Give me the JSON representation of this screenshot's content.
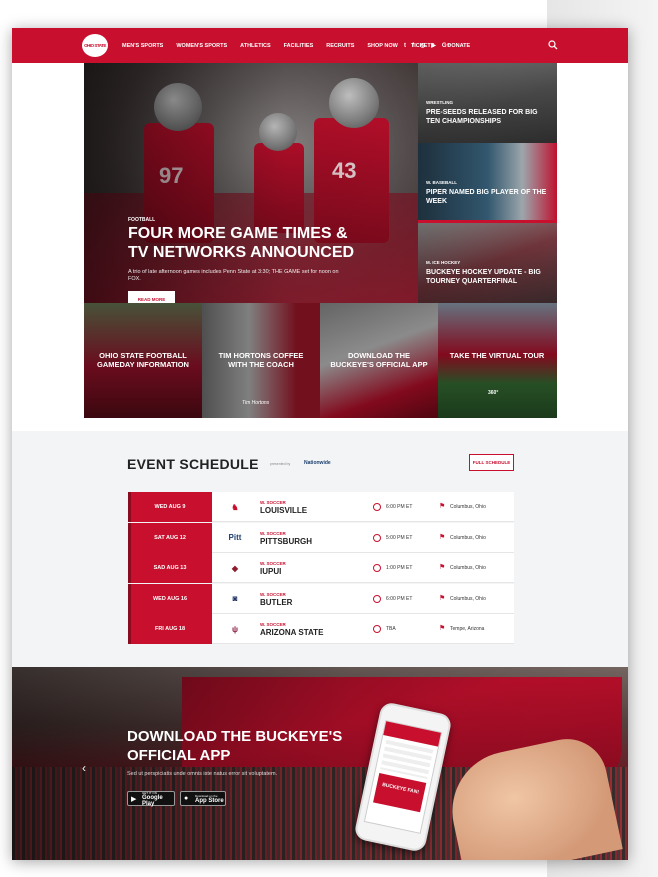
{
  "nav": {
    "logo_text": "OHIO STATE",
    "links": [
      "MEN'S SPORTS",
      "WOMEN'S SPORTS",
      "ATHLETICS",
      "FACILITIES",
      "RECRUITS",
      "SHOP NOW",
      "TICKETS",
      "DONATE"
    ],
    "socials": [
      "t",
      "f",
      "◎",
      "▶",
      "G+"
    ]
  },
  "hero": {
    "category": "FOOTBALL",
    "title": "FOUR MORE GAME TIMES & TV NETWORKS ANNOUNCED",
    "description": "A trio of late afternoon games includes Penn State at 3:30; THE GAME set for noon on FOX.",
    "button": "READ MORE",
    "jersey_numbers": [
      "97",
      "43"
    ]
  },
  "side_stories": [
    {
      "category": "WRESTLING",
      "title": "PRE-SEEDS RELEASED FOR BIG TEN CHAMPIONSHIPS"
    },
    {
      "category": "W. BASEBALL",
      "title": "PIPER NAMED BIG PLAYER OF THE WEEK"
    },
    {
      "category": "M. ICE HOCKEY",
      "title": "BUCKEYE HOCKEY UPDATE - BIG TOURNEY QUARTERFINAL"
    }
  ],
  "tiles": [
    {
      "title": "OHIO STATE FOOTBALL GAMEDAY INFORMATION"
    },
    {
      "title": "TIM HORTONS COFFEE WITH THE COACH",
      "sponsor": "Tim Hortons"
    },
    {
      "title": "DOWNLOAD THE BUCKEYE'S OFFICIAL APP"
    },
    {
      "title": "TAKE THE VIRTUAL TOUR",
      "badge": "360°"
    }
  ],
  "schedule": {
    "title": "EVENT SCHEDULE",
    "presented_by": "presented by",
    "sponsor": "Nationwide",
    "full_button": "FULL SCHEDULE",
    "events": [
      {
        "date": "WED AUG 9",
        "logo": "♞",
        "logo_color": "#c8102e",
        "sport": "W. SOCCER",
        "opponent": "LOUISVILLE",
        "time": "6:00 PM ET",
        "location": "Columbus, Ohio"
      },
      {
        "date": "SAT AUG 12",
        "logo": "Pitt",
        "logo_color": "#1d3f6e",
        "sport": "W. SOCCER",
        "opponent": "PITTSBURGH",
        "time": "5:00 PM ET",
        "location": "Columbus, Ohio"
      },
      {
        "date": "SAD AUG 13",
        "logo": "◆",
        "logo_color": "#8b1d2c",
        "sport": "W. SOCCER",
        "opponent": "IUPUI",
        "time": "1:00 PM ET",
        "location": "Columbus, Ohio"
      },
      {
        "date": "WED AUG 16",
        "logo": "◙",
        "logo_color": "#1d2d5e",
        "sport": "W. SOCCER",
        "opponent": "BUTLER",
        "time": "6:00 PM ET",
        "location": "Columbus, Ohio"
      },
      {
        "date": "FRI AUG 18",
        "logo": "ψ",
        "logo_color": "#8c1d40",
        "sport": "W. SOCCER",
        "opponent": "ARIZONA STATE",
        "time": "TBA",
        "location": "Tempe, Arizona"
      }
    ]
  },
  "promo": {
    "title": "DOWNLOAD THE BUCKEYE'S OFFICIAL APP",
    "description": "Sed ut perspiciatis unde omnis iste natus error sit voluptatem.",
    "google_l1": "GET IT ON",
    "google_l2": "Google Play",
    "apple_l1": "Download on the",
    "apple_l2": "App Store",
    "prev": "‹",
    "next": "›",
    "phone_ad": "BUCKEYE FAN!"
  },
  "colors": {
    "brand": "#c8102e",
    "brand_dark": "#8a0b1f",
    "panel": "#f2f4f6"
  }
}
